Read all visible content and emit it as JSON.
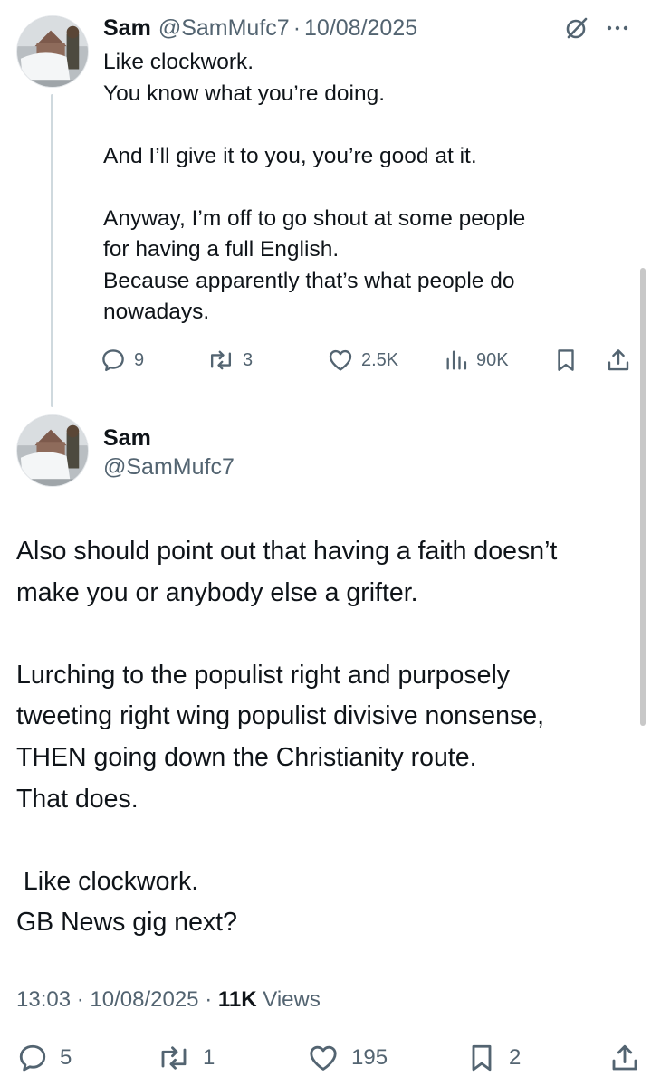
{
  "parent_tweet": {
    "name": "Sam",
    "handle": "@SamMufc7",
    "separator": "·",
    "date": "10/08/2025",
    "icons": {
      "grok": "grok-icon",
      "more": "more-icon"
    },
    "lines": [
      "Like clockwork.",
      "You know what you’re doing.",
      "",
      "And I’ll give it to you, you’re good at it.",
      "",
      "Anyway, I’m off to go shout at some people",
      "for having a full English.",
      "Because apparently that’s what people do",
      "nowadays."
    ],
    "actions": {
      "replies": "9",
      "reposts": "3",
      "likes": "2.5K",
      "views": "90K"
    }
  },
  "main_tweet": {
    "name": "Sam",
    "handle": "@SamMufc7",
    "lines": [
      "Also should point out that having a faith doesn’t",
      "make you or anybody else a grifter.",
      "",
      "Lurching to the populist right and purposely",
      "tweeting right wing populist divisive nonsense,",
      "THEN going down the Christianity route.",
      "That does.",
      "",
      " Like clockwork.",
      "GB News gig next?"
    ],
    "meta": {
      "time": "13:03",
      "separator": "·",
      "date": "10/08/2025",
      "views_count": "11K",
      "views_label": "Views"
    },
    "actions": {
      "replies": "5",
      "reposts": "1",
      "likes": "195",
      "bookmarks": "2"
    }
  },
  "colors": {
    "text": "#0f1419",
    "secondary": "#536471",
    "thread_line": "#cfd9de"
  }
}
